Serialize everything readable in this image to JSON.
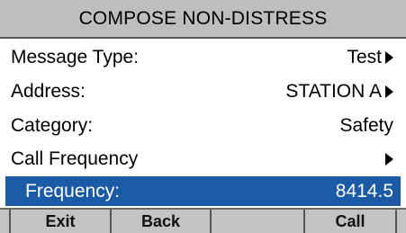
{
  "header": {
    "title": "COMPOSE NON-DISTRESS"
  },
  "menu": {
    "items": [
      {
        "label": "Message Type:",
        "value": "Test",
        "has_arrow": true
      },
      {
        "label": "Address:",
        "value": "STATION A",
        "has_arrow": true
      },
      {
        "label": "Category:",
        "value": "Safety",
        "has_arrow": false
      },
      {
        "label": "Call Frequency",
        "value": "",
        "has_arrow": true
      },
      {
        "label": "Frequency:",
        "value": "8414.5",
        "has_arrow": false,
        "selected": true
      }
    ]
  },
  "softkeys": [
    {
      "label": "Exit"
    },
    {
      "label": "Back"
    },
    {
      "label": ""
    },
    {
      "label": "Call"
    }
  ],
  "colors": {
    "title_bg": "#bebebe",
    "selection_bg": "#1b5aa5",
    "softkey_bg": "#c3c3c3"
  },
  "icons": {
    "submenu_arrow": "triangle-right-icon"
  }
}
